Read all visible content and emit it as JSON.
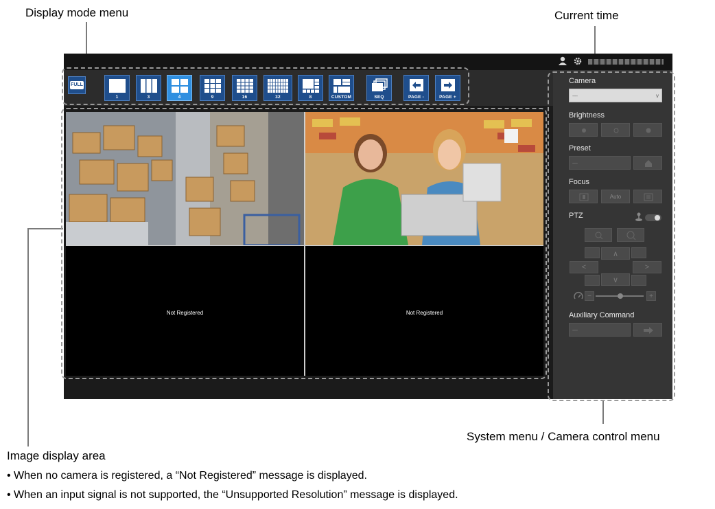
{
  "callouts": {
    "display_mode_menu": "Display mode menu",
    "current_time": "Current time",
    "system_menu": "System menu / Camera control menu",
    "image_display_area": "Image display area"
  },
  "descriptions": [
    "• When no camera is registered, a “Not Registered” message is displayed.",
    "• When an input signal is not supported, the “Unsupported Resolution” message is displayed."
  ],
  "toolbar": {
    "full": "FULL",
    "buttons": [
      "1",
      "3",
      "4",
      "9",
      "16",
      "32",
      "8",
      "CUSTOM",
      "SEQ",
      "PAGE -",
      "PAGE +"
    ],
    "active": "4"
  },
  "video": {
    "not_registered_1": "Not Registered",
    "not_registered_2": "Not Registered"
  },
  "panel": {
    "camera_label": "Camera",
    "camera_value": "---",
    "brightness_label": "Brightness",
    "preset_label": "Preset",
    "preset_value": "---",
    "focus_label": "Focus",
    "focus_auto": "Auto",
    "ptz_label": "PTZ",
    "aux_label": "Auxiliary Command",
    "aux_value": "---"
  },
  "colors": {
    "toolbar_button": "#1f4e8c",
    "toolbar_button_active": "#2f8fe0",
    "panel_bg": "#353535"
  }
}
